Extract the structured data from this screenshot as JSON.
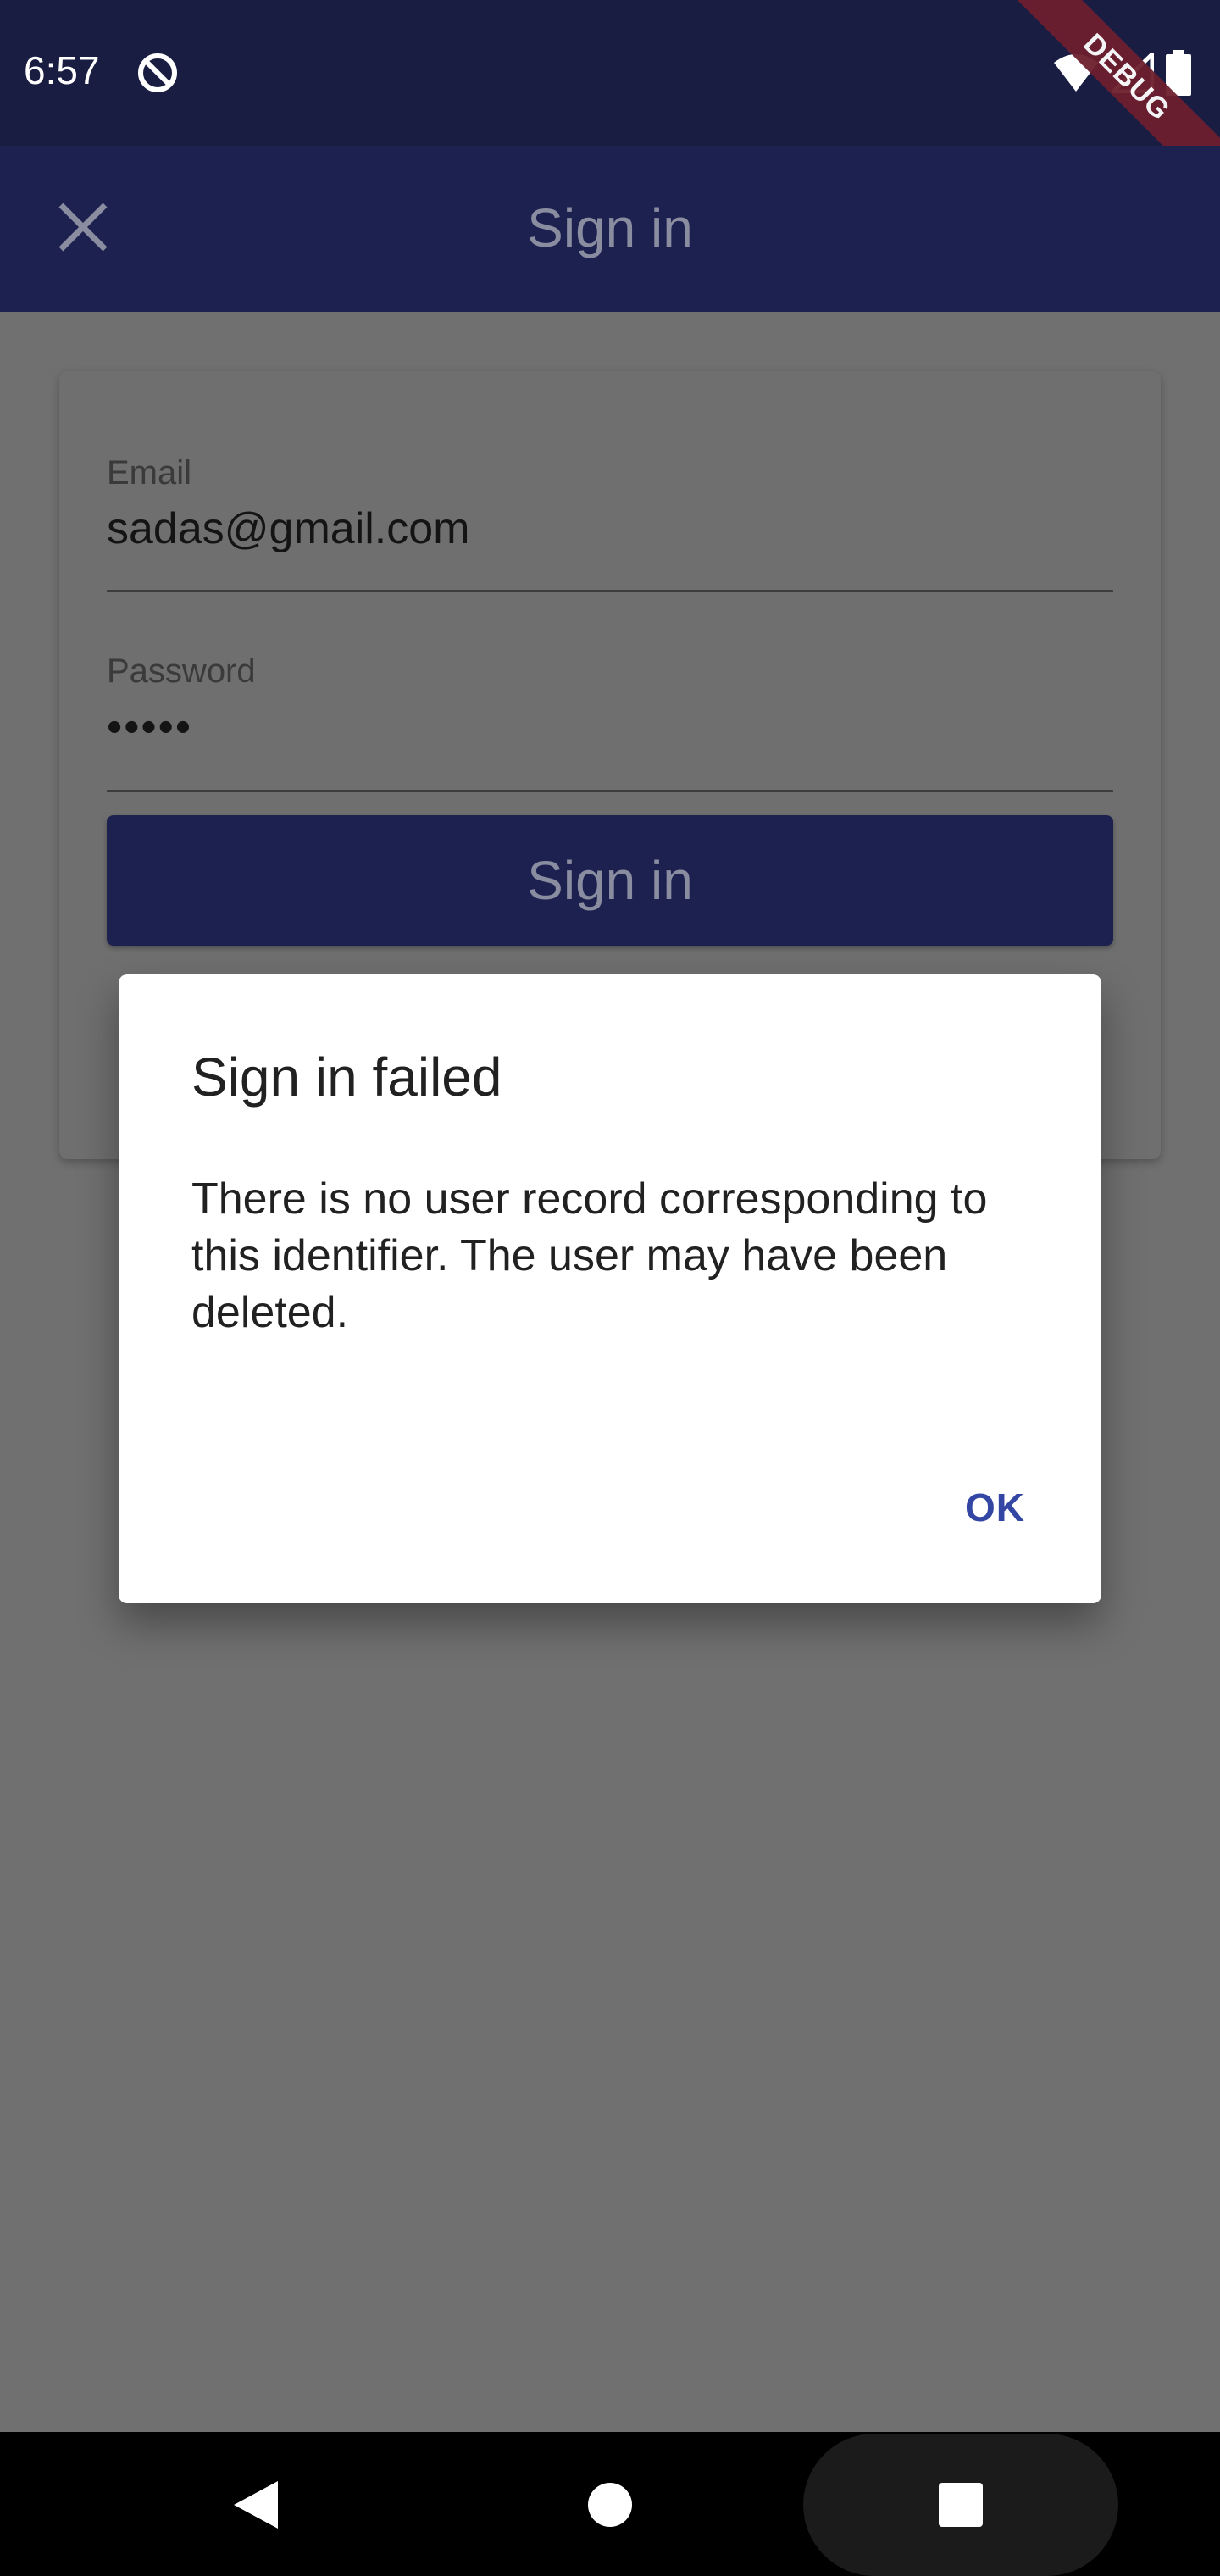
{
  "status_bar": {
    "time": "6:57",
    "icons": [
      "sync-icon",
      "wifi-icon",
      "signal-icon",
      "battery-icon"
    ],
    "debug_label": "DEBUG"
  },
  "app_bar": {
    "title": "Sign in",
    "close_icon": "close-icon"
  },
  "form": {
    "email_label": "Email",
    "email_value": "sadas@gmail.com",
    "password_label": "Password",
    "password_value": "•••••",
    "submit_label": "Sign in"
  },
  "dialog": {
    "title": "Sign in failed",
    "message": "There is no user record corresponding to this identifier. The user may have been deleted.",
    "ok_label": "OK"
  },
  "nav_bar": {
    "icons": [
      "back-icon",
      "home-icon",
      "recents-icon"
    ]
  },
  "colors": {
    "status_bar": "#1a1d42",
    "app_bar": "#1d2150",
    "scrim_background": "#707070",
    "dialog_background": "#ffffff",
    "accent": "#3346a3"
  }
}
